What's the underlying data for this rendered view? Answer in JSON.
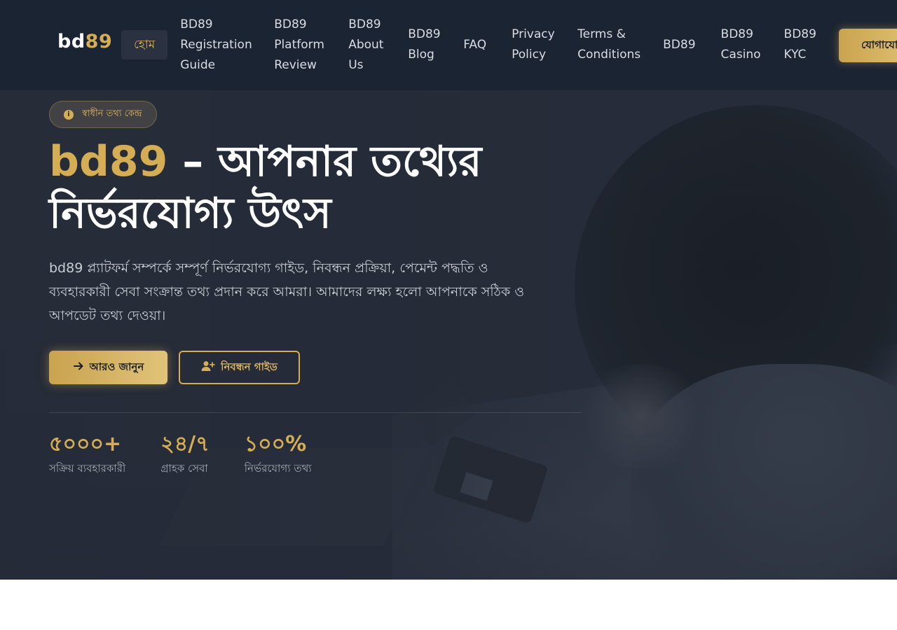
{
  "header": {
    "logo": {
      "part1": "bd",
      "part2": "89"
    },
    "nav": [
      {
        "label": "হোম",
        "active": true
      },
      {
        "label": "BD89 Registration Guide"
      },
      {
        "label": "BD89 Platform Review"
      },
      {
        "label": "BD89 About Us"
      },
      {
        "label": "BD89 Blog"
      },
      {
        "label": "FAQ"
      },
      {
        "label": "Privacy Policy"
      },
      {
        "label": "Terms & Conditions"
      },
      {
        "label": "BD89"
      },
      {
        "label": "BD89 Casino"
      },
      {
        "label": "BD89 KYC"
      }
    ],
    "join_label": "যোগাযো"
  },
  "hero": {
    "badge": "স্বাধীন তথ্য কেন্দ্র",
    "title_accent": "bd89",
    "title_rest": " – আপনার তথ্যের নির্ভরযোগ্য উৎস",
    "description": "bd89 প্ল্যাটফর্ম সম্পর্কে সম্পূর্ণ নির্ভরযোগ্য গাইড, নিবন্ধন প্রক্রিয়া, পেমেন্ট পদ্ধতি ও ব্যবহারকারী সেবা সংক্রান্ত তথ্য প্রদান করে আমরা। আমাদের লক্ষ্য হলো আপনাকে সঠিক ও আপডেট তথ্য দেওয়া।",
    "primary_button": "আরও জানুন",
    "secondary_button": "নিবন্ধন গাইড",
    "stats": [
      {
        "value": "৫০০০+",
        "label": "সক্রিয় ব্যবহারকারী"
      },
      {
        "value": "২৪/৭",
        "label": "গ্রাহক সেবা"
      },
      {
        "value": "১০০%",
        "label": "নির্ভরযোগ্য তথ্য"
      }
    ]
  },
  "colors": {
    "header_bg": "#1b2433",
    "accent_gold": "#d4ad55",
    "hero_bg": "#262d3a"
  }
}
